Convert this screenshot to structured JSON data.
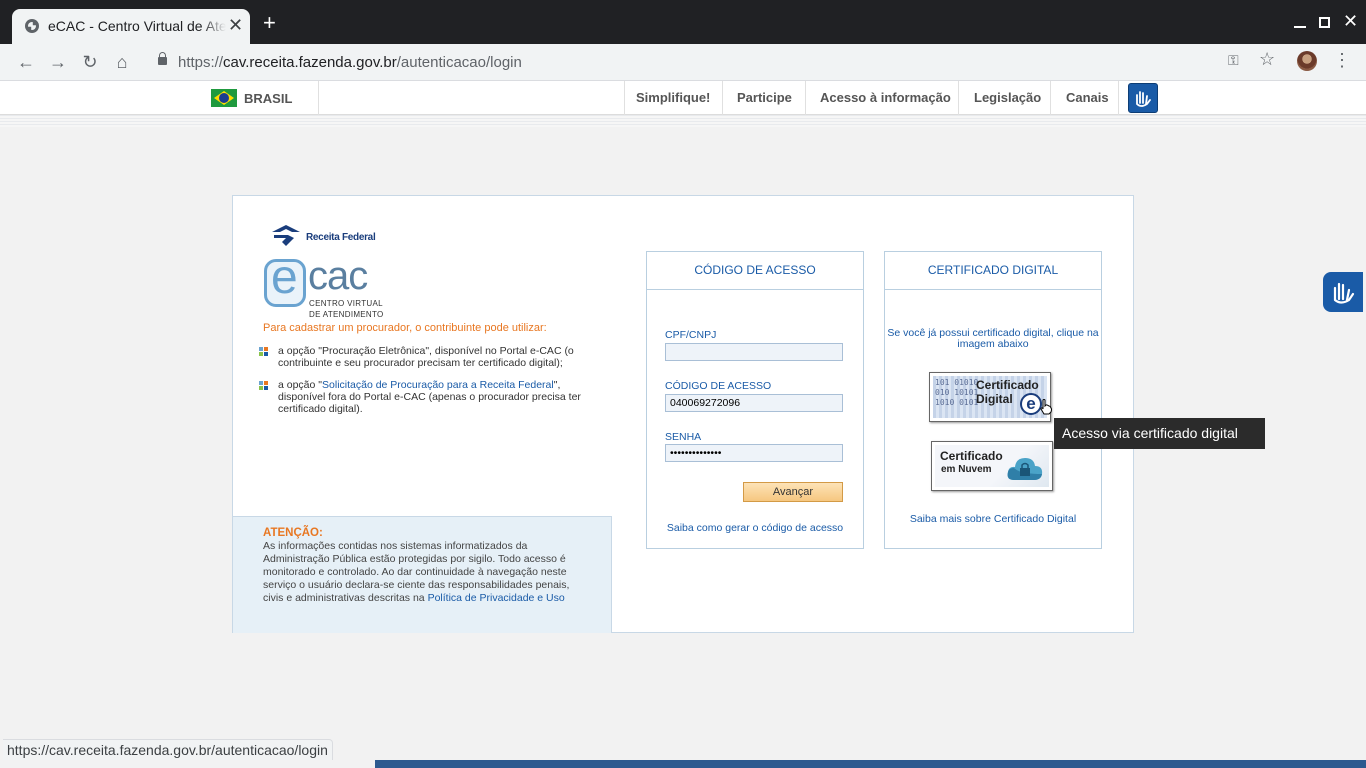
{
  "browser": {
    "tab_title": "eCAC - Centro Virtual de Atendimento",
    "url_scheme": "https://",
    "url_host": "cav.receita.fazenda.gov.br",
    "url_path": "/autenticacao/login",
    "status_url": "https://cav.receita.fazenda.gov.br/autenticacao/login"
  },
  "govbar": {
    "country": "BRASIL",
    "links": [
      "Simplifique!",
      "Participe",
      "Acesso à informação",
      "Legislação",
      "Canais"
    ]
  },
  "brand": {
    "receita": "Receita Federal",
    "ecac_e": "e",
    "ecac_cac": "cac",
    "subtitle_1": "CENTRO VIRTUAL",
    "subtitle_2": "DE ATENDIMENTO"
  },
  "procurador": {
    "title": "Para cadastrar um procurador, o contribuinte pode utilizar:",
    "item1_text": "a opção \"Procuração Eletrônica\", disponível no Portal e-CAC (o contribuinte e seu procurador precisam ter certificado digital);",
    "item2_prefix": "a opção \"",
    "item2_link": "Solicitação de Procuração para a Receita Federal",
    "item2_suffix": "\", disponível fora do Portal e-CAC (apenas o procurador precisa ter certificado digital)."
  },
  "attention": {
    "title": "ATENÇÃO:",
    "text": "As informações contidas nos sistemas informatizados da Administração Pública estão protegidas por sigilo. Todo acesso é monitorado e controlado. Ao dar continuidade à navegação neste serviço o usuário declara-se ciente das responsabilidades penais, civis e administrativas descritas na ",
    "link": "Política de Privacidade e Uso"
  },
  "codigo_panel": {
    "title": "CÓDIGO DE ACESSO",
    "cpf_label": "CPF/CNPJ",
    "cpf_value": "",
    "codigo_label": "CÓDIGO DE ACESSO",
    "codigo_value": "040069272096",
    "senha_label": "SENHA",
    "senha_value": "••••••••••••••",
    "button": "Avançar",
    "help_link": "Saiba como gerar o código de acesso"
  },
  "cert_panel": {
    "title": "CERTIFICADO DIGITAL",
    "intro": "Se você já possui certificado digital, clique na imagem abaixo",
    "cert_digital_line1": "Certificado",
    "cert_digital_line2": "Digital",
    "cert_e": "e",
    "cert_binary": "101 01010\n010 10101\n1010 0101",
    "cert_nuvem_line1": "Certificado",
    "cert_nuvem_line2": "em Nuvem",
    "help_link": "Saiba mais sobre Certificado Digital"
  },
  "tooltip": "Acesso via certificado digital",
  "colors": {
    "accent_blue": "#1a5ba7",
    "orange": "#e87722",
    "attention_bg": "#e6f0f7"
  }
}
